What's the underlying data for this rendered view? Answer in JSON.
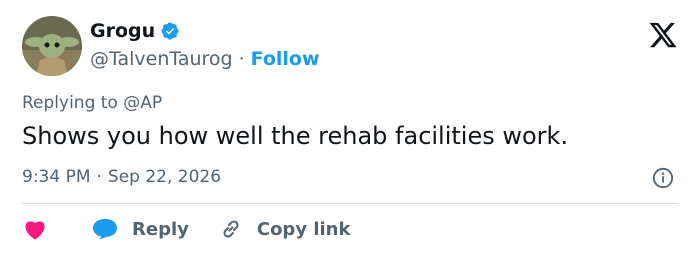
{
  "author": {
    "display_name": "Grogu",
    "handle": "@TalvenTaurog",
    "follow_label": "Follow",
    "separator": "·",
    "verified": true
  },
  "tweet": {
    "replying_prefix": "Replying to",
    "replying_to": "@AP",
    "text": "Shows you how well the rehab facilities work.",
    "time": "9:34 PM",
    "date": "Sep 22, 2026",
    "separator": "·"
  },
  "actions": {
    "like_icon": "heart-icon",
    "reply_label": "Reply",
    "copy_link_label": "Copy link"
  },
  "colors": {
    "accent": "#1d9bf0",
    "like": "#f91880",
    "muted_text": "#536471",
    "text": "#0f1419"
  }
}
